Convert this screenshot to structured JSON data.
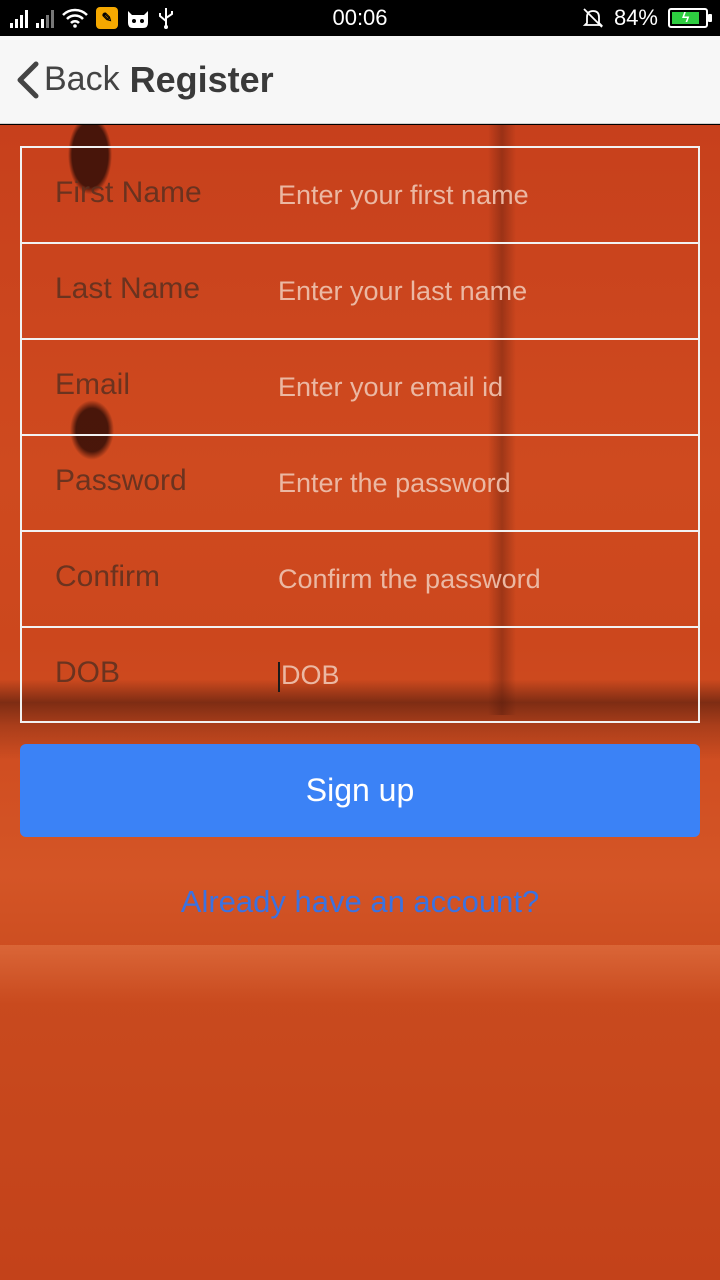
{
  "status_bar": {
    "time": "00:06",
    "battery_percent": "84%",
    "battery_level": 0.84
  },
  "header": {
    "back_label": "Back",
    "title": "Register"
  },
  "form": {
    "fields": [
      {
        "label": "First Name",
        "placeholder": "Enter your first name",
        "value": ""
      },
      {
        "label": "Last Name",
        "placeholder": "Enter your last name",
        "value": ""
      },
      {
        "label": "Email",
        "placeholder": "Enter your email id",
        "value": ""
      },
      {
        "label": "Password",
        "placeholder": "Enter the password",
        "value": ""
      },
      {
        "label": "Confirm",
        "placeholder": "Confirm the password",
        "value": ""
      },
      {
        "label": "DOB",
        "placeholder": "DOB",
        "value": ""
      }
    ],
    "submit_label": "Sign up",
    "login_link": "Already have an account?"
  },
  "colors": {
    "primary_button": "#3b82f6",
    "link": "#3b72e0",
    "battery_fill": "#2ecc40"
  }
}
